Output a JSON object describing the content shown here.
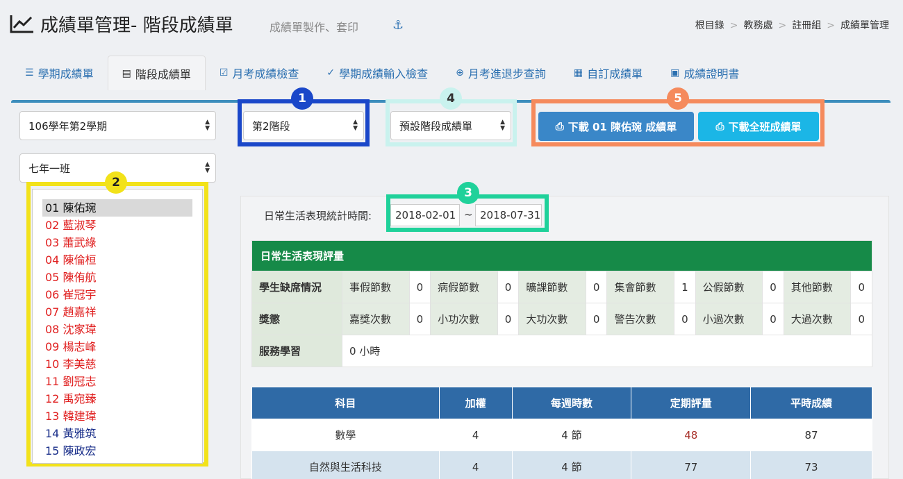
{
  "header": {
    "title": "成績單管理- 階段成績單",
    "subtitle": "成績單製作、套印",
    "breadcrumb": [
      "根目錄",
      "教務處",
      "註冊組",
      "成績單管理"
    ],
    "breadcrumb_sep": ">"
  },
  "tabs": [
    {
      "label": "學期成績單",
      "icon": "list-icon"
    },
    {
      "label": "階段成績單",
      "icon": "list-alt-icon"
    },
    {
      "label": "月考成績檢查",
      "icon": "check-square-icon"
    },
    {
      "label": "學期成績輸入檢查",
      "icon": "check-circle-icon"
    },
    {
      "label": "月考進退步查詢",
      "icon": "search-plus-icon"
    },
    {
      "label": "自訂成績單",
      "icon": "newspaper-icon"
    },
    {
      "label": "成績證明書",
      "icon": "id-card-icon"
    }
  ],
  "filters": {
    "semester": "106學年第2學期",
    "class": "七年一班",
    "stage": "第2階段",
    "template": "預設階段成績單"
  },
  "buttons": {
    "download_student": "下載 01 陳佑琬 成績單",
    "download_class": "下載全班成績單"
  },
  "badges": [
    "1",
    "2",
    "3",
    "4",
    "5"
  ],
  "students": [
    {
      "label": "01 陳佑琬",
      "color": "selected"
    },
    {
      "label": "02 藍淑琴",
      "color": "red"
    },
    {
      "label": "03 蕭武綠",
      "color": "red"
    },
    {
      "label": "04 陳倫桓",
      "color": "red"
    },
    {
      "label": "05 陳侑航",
      "color": "red"
    },
    {
      "label": "06 崔冠宇",
      "color": "red"
    },
    {
      "label": "07 趙嘉祥",
      "color": "red"
    },
    {
      "label": "08 沈家瑋",
      "color": "red"
    },
    {
      "label": "09 楊志峰",
      "color": "red"
    },
    {
      "label": "10 李美慈",
      "color": "red"
    },
    {
      "label": "11 劉冠志",
      "color": "red"
    },
    {
      "label": "12 禹宛臻",
      "color": "red"
    },
    {
      "label": "13 韓建瑋",
      "color": "red"
    },
    {
      "label": "14 黃雅筑",
      "color": "blue"
    },
    {
      "label": "15 陳政宏",
      "color": "blue"
    }
  ],
  "date_range": {
    "label": "日常生活表現統計時間:",
    "start": "2018-02-01",
    "sep": "~",
    "end": "2018-07-31"
  },
  "daily_life": {
    "title": "日常生活表現評量",
    "attendance": {
      "category": "學生缺席情況",
      "items": [
        {
          "label": "事假節數",
          "value": "0"
        },
        {
          "label": "病假節數",
          "value": "0"
        },
        {
          "label": "曠課節數",
          "value": "0"
        },
        {
          "label": "集會節數",
          "value": "1"
        },
        {
          "label": "公假節數",
          "value": "0"
        },
        {
          "label": "其他節數",
          "value": "0"
        }
      ]
    },
    "rewards": {
      "category": "獎懲",
      "items": [
        {
          "label": "嘉獎次數",
          "value": "0"
        },
        {
          "label": "小功次數",
          "value": "0"
        },
        {
          "label": "大功次數",
          "value": "0"
        },
        {
          "label": "警告次數",
          "value": "0"
        },
        {
          "label": "小過次數",
          "value": "0"
        },
        {
          "label": "大過次數",
          "value": "0"
        }
      ]
    },
    "service": {
      "category": "服務學習",
      "value": "0 小時"
    }
  },
  "grades": {
    "headers": [
      "科目",
      "加權",
      "每週時數",
      "定期評量",
      "平時成績"
    ],
    "rows": [
      [
        "數學",
        "4",
        "4 節",
        "48",
        "87"
      ],
      [
        "自然與生活科技",
        "4",
        "4 節",
        "77",
        "73"
      ]
    ]
  },
  "colors": {
    "badge1": "#1a47c9",
    "badge2": "#f2e21a",
    "badge3": "#1fd19a",
    "badge4": "#c9f2ee",
    "badge5": "#f58a5c",
    "btn_student": "#3a87c8",
    "btn_class": "#1bb6e6"
  }
}
